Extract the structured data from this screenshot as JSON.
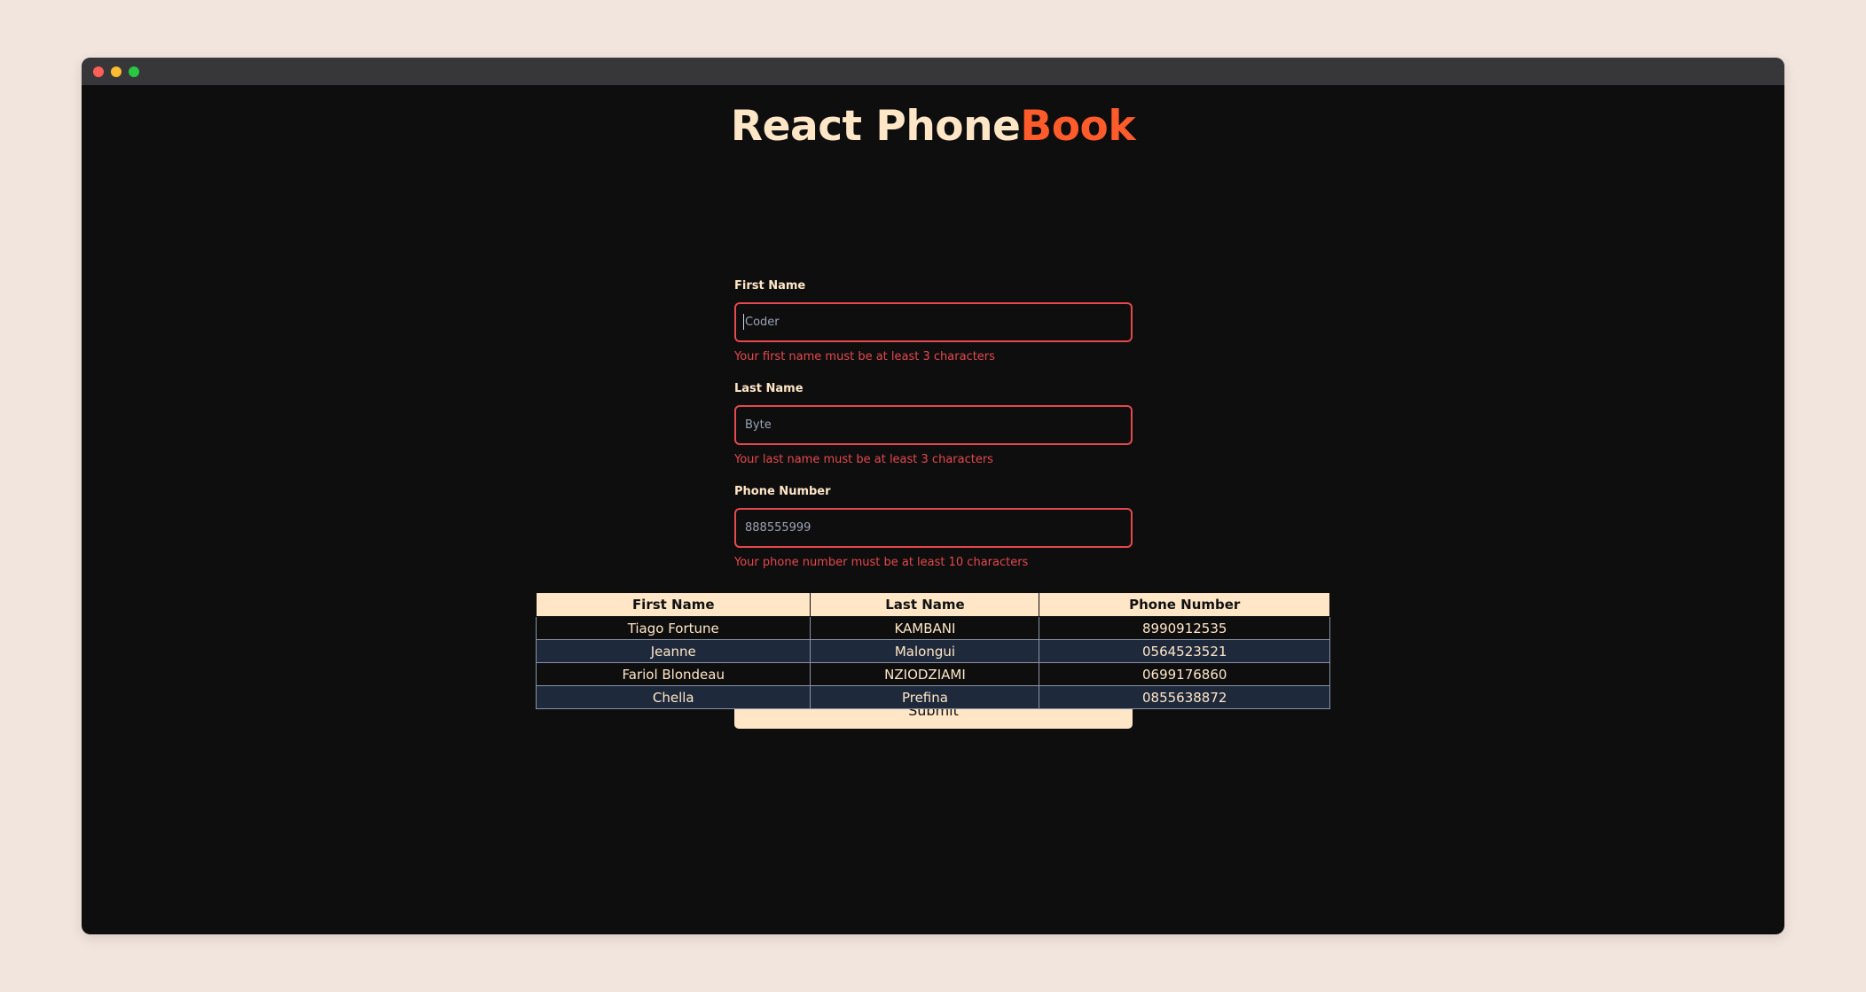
{
  "title": {
    "part1": "React Phone",
    "part2": "Book"
  },
  "form": {
    "first_name": {
      "label": "First Name",
      "placeholder": "Coder",
      "error": "Your first name must be at least 3 characters"
    },
    "last_name": {
      "label": "Last Name",
      "placeholder": "Byte",
      "error": "Your last name must be at least 3 characters"
    },
    "phone": {
      "label": "Phone Number",
      "placeholder": "888555999",
      "error": "Your phone number must be at least 10 characters"
    },
    "submit_label": "Submit"
  },
  "table": {
    "headers": [
      "First Name",
      "Last Name",
      "Phone Number"
    ],
    "rows": [
      [
        "Tiago Fortune",
        "KAMBANI",
        "8990912535"
      ],
      [
        "Jeanne",
        "Malongui",
        "0564523521"
      ],
      [
        "Fariol Blondeau",
        "NZIODZIAMI",
        "0699176860"
      ],
      [
        "Chella",
        "Prefina",
        "0855638872"
      ]
    ]
  },
  "colors": {
    "background": "#0e0e0e",
    "cream": "#ffe6c7",
    "accent": "#ff5b2b",
    "error": "#e5484d",
    "row_alt": "#1e293b"
  }
}
